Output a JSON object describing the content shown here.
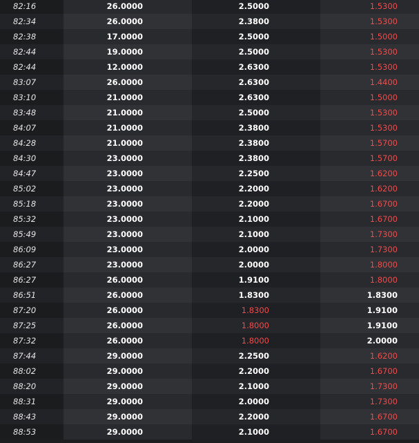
{
  "colors": {
    "highlight": "#f04a4a",
    "normal": "#ffffff"
  },
  "rows": [
    {
      "time": "82:16",
      "a": "26.0000",
      "b": "2.5000",
      "b_hl": false,
      "c": "1.5300",
      "c_hl": true
    },
    {
      "time": "82:34",
      "a": "26.0000",
      "b": "2.3800",
      "b_hl": false,
      "c": "1.5300",
      "c_hl": true
    },
    {
      "time": "82:38",
      "a": "17.0000",
      "b": "2.5000",
      "b_hl": false,
      "c": "1.5000",
      "c_hl": true
    },
    {
      "time": "82:44",
      "a": "19.0000",
      "b": "2.5000",
      "b_hl": false,
      "c": "1.5300",
      "c_hl": true
    },
    {
      "time": "82:44",
      "a": "12.0000",
      "b": "2.6300",
      "b_hl": false,
      "c": "1.5300",
      "c_hl": true
    },
    {
      "time": "83:07",
      "a": "26.0000",
      "b": "2.6300",
      "b_hl": false,
      "c": "1.4400",
      "c_hl": true
    },
    {
      "time": "83:10",
      "a": "21.0000",
      "b": "2.6300",
      "b_hl": false,
      "c": "1.5000",
      "c_hl": true
    },
    {
      "time": "83:48",
      "a": "21.0000",
      "b": "2.5000",
      "b_hl": false,
      "c": "1.5300",
      "c_hl": true
    },
    {
      "time": "84:07",
      "a": "21.0000",
      "b": "2.3800",
      "b_hl": false,
      "c": "1.5300",
      "c_hl": true
    },
    {
      "time": "84:28",
      "a": "21.0000",
      "b": "2.3800",
      "b_hl": false,
      "c": "1.5700",
      "c_hl": true
    },
    {
      "time": "84:30",
      "a": "23.0000",
      "b": "2.3800",
      "b_hl": false,
      "c": "1.5700",
      "c_hl": true
    },
    {
      "time": "84:47",
      "a": "23.0000",
      "b": "2.2500",
      "b_hl": false,
      "c": "1.6200",
      "c_hl": true
    },
    {
      "time": "85:02",
      "a": "23.0000",
      "b": "2.2000",
      "b_hl": false,
      "c": "1.6200",
      "c_hl": true
    },
    {
      "time": "85:18",
      "a": "23.0000",
      "b": "2.2000",
      "b_hl": false,
      "c": "1.6700",
      "c_hl": true
    },
    {
      "time": "85:32",
      "a": "23.0000",
      "b": "2.1000",
      "b_hl": false,
      "c": "1.6700",
      "c_hl": true
    },
    {
      "time": "85:49",
      "a": "23.0000",
      "b": "2.1000",
      "b_hl": false,
      "c": "1.7300",
      "c_hl": true
    },
    {
      "time": "86:09",
      "a": "23.0000",
      "b": "2.0000",
      "b_hl": false,
      "c": "1.7300",
      "c_hl": true
    },
    {
      "time": "86:27",
      "a": "23.0000",
      "b": "2.0000",
      "b_hl": false,
      "c": "1.8000",
      "c_hl": true
    },
    {
      "time": "86:27",
      "a": "26.0000",
      "b": "1.9100",
      "b_hl": false,
      "c": "1.8000",
      "c_hl": true
    },
    {
      "time": "86:51",
      "a": "26.0000",
      "b": "1.8300",
      "b_hl": false,
      "c": "1.8300",
      "c_hl": false
    },
    {
      "time": "87:20",
      "a": "26.0000",
      "b": "1.8300",
      "b_hl": true,
      "c": "1.9100",
      "c_hl": false
    },
    {
      "time": "87:25",
      "a": "26.0000",
      "b": "1.8000",
      "b_hl": true,
      "c": "1.9100",
      "c_hl": false
    },
    {
      "time": "87:32",
      "a": "26.0000",
      "b": "1.8000",
      "b_hl": true,
      "c": "2.0000",
      "c_hl": false
    },
    {
      "time": "87:44",
      "a": "29.0000",
      "b": "2.2500",
      "b_hl": false,
      "c": "1.6200",
      "c_hl": true
    },
    {
      "time": "88:02",
      "a": "29.0000",
      "b": "2.2000",
      "b_hl": false,
      "c": "1.6700",
      "c_hl": true
    },
    {
      "time": "88:20",
      "a": "29.0000",
      "b": "2.1000",
      "b_hl": false,
      "c": "1.7300",
      "c_hl": true
    },
    {
      "time": "88:31",
      "a": "29.0000",
      "b": "2.0000",
      "b_hl": false,
      "c": "1.7300",
      "c_hl": true
    },
    {
      "time": "88:43",
      "a": "29.0000",
      "b": "2.2000",
      "b_hl": false,
      "c": "1.6700",
      "c_hl": true
    },
    {
      "time": "88:53",
      "a": "29.0000",
      "b": "2.1000",
      "b_hl": false,
      "c": "1.6700",
      "c_hl": true
    }
  ]
}
